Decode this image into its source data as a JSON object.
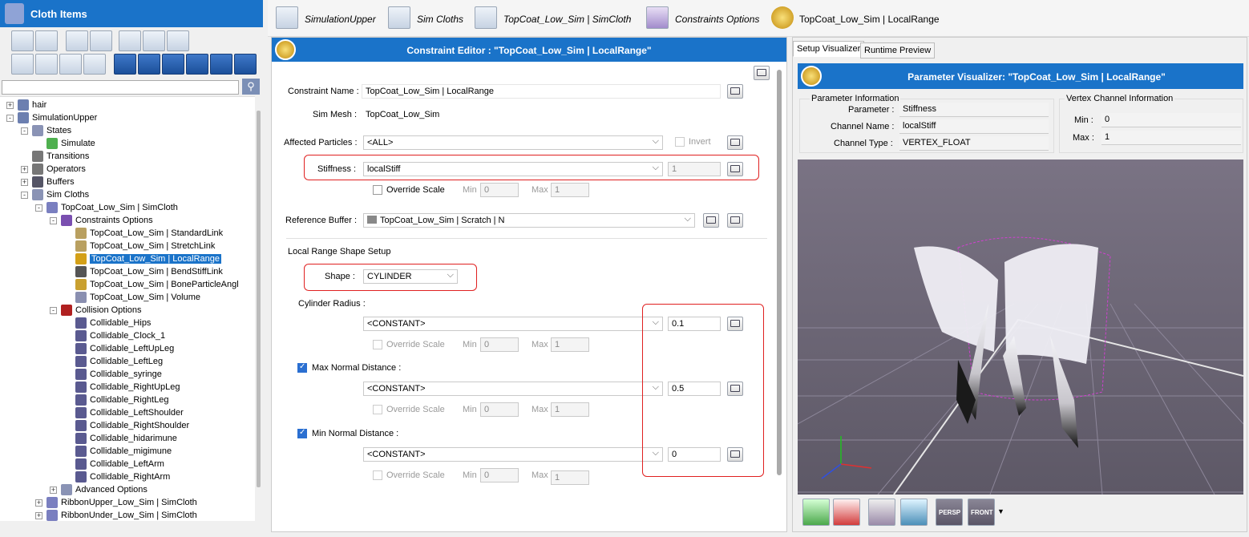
{
  "left_panel": {
    "title": "Cloth Items",
    "tree": [
      {
        "label": "hair",
        "indent": 0,
        "exp": "+",
        "color": "#6c7fb0"
      },
      {
        "label": "SimulationUpper",
        "indent": 0,
        "exp": "-",
        "color": "#6c7fb0"
      },
      {
        "label": "States",
        "indent": 1,
        "exp": "-",
        "color": "#8a93b5"
      },
      {
        "label": "Simulate",
        "indent": 2,
        "exp": "",
        "color": "#4fb04f"
      },
      {
        "label": "Transitions",
        "indent": 1,
        "exp": "",
        "color": "#777"
      },
      {
        "label": "Operators",
        "indent": 1,
        "exp": "+",
        "color": "#777"
      },
      {
        "label": "Buffers",
        "indent": 1,
        "exp": "+",
        "color": "#556"
      },
      {
        "label": "Sim Cloths",
        "indent": 1,
        "exp": "-",
        "color": "#8a93b5"
      },
      {
        "label": "TopCoat_Low_Sim | SimCloth",
        "indent": 2,
        "exp": "-",
        "color": "#7a7fc0"
      },
      {
        "label": "Constraints Options",
        "indent": 3,
        "exp": "-",
        "color": "#7a4fb0"
      },
      {
        "label": "TopCoat_Low_Sim | StandardLink",
        "indent": 4,
        "exp": "",
        "color": "#b9a060"
      },
      {
        "label": "TopCoat_Low_Sim | StretchLink",
        "indent": 4,
        "exp": "",
        "color": "#b9a060"
      },
      {
        "label": "TopCoat_Low_Sim | LocalRange",
        "indent": 4,
        "exp": "",
        "color": "#d4a017",
        "selected": true
      },
      {
        "label": "TopCoat_Low_Sim | BendStiffLink",
        "indent": 4,
        "exp": "",
        "color": "#555"
      },
      {
        "label": "TopCoat_Low_Sim | BoneParticleAngl",
        "indent": 4,
        "exp": "",
        "color": "#c9a030"
      },
      {
        "label": "TopCoat_Low_Sim | Volume",
        "indent": 4,
        "exp": "",
        "color": "#8a8fb0"
      },
      {
        "label": "Collision Options",
        "indent": 3,
        "exp": "-",
        "color": "#b02020"
      },
      {
        "label": "Collidable_Hips",
        "indent": 4,
        "exp": "",
        "color": "#5a5a90"
      },
      {
        "label": "Collidable_Clock_1",
        "indent": 4,
        "exp": "",
        "color": "#5a5a90"
      },
      {
        "label": "Collidable_LeftUpLeg",
        "indent": 4,
        "exp": "",
        "color": "#5a5a90"
      },
      {
        "label": "Collidable_LeftLeg",
        "indent": 4,
        "exp": "",
        "color": "#5a5a90"
      },
      {
        "label": "Collidable_syringe",
        "indent": 4,
        "exp": "",
        "color": "#5a5a90"
      },
      {
        "label": "Collidable_RightUpLeg",
        "indent": 4,
        "exp": "",
        "color": "#5a5a90"
      },
      {
        "label": "Collidable_RightLeg",
        "indent": 4,
        "exp": "",
        "color": "#5a5a90"
      },
      {
        "label": "Collidable_LeftShoulder",
        "indent": 4,
        "exp": "",
        "color": "#5a5a90"
      },
      {
        "label": "Collidable_RightShoulder",
        "indent": 4,
        "exp": "",
        "color": "#5a5a90"
      },
      {
        "label": "Collidable_hidarimune",
        "indent": 4,
        "exp": "",
        "color": "#5a5a90"
      },
      {
        "label": "Collidable_migimune",
        "indent": 4,
        "exp": "",
        "color": "#5a5a90"
      },
      {
        "label": "Collidable_LeftArm",
        "indent": 4,
        "exp": "",
        "color": "#5a5a90"
      },
      {
        "label": "Collidable_RightArm",
        "indent": 4,
        "exp": "",
        "color": "#5a5a90"
      },
      {
        "label": "Advanced Options",
        "indent": 3,
        "exp": "+",
        "color": "#8a93b5"
      },
      {
        "label": "RibbonUpper_Low_Sim | SimCloth",
        "indent": 2,
        "exp": "+",
        "color": "#7a7fc0"
      },
      {
        "label": "RibbonUnder_Low_Sim | SimCloth",
        "indent": 2,
        "exp": "+",
        "color": "#7a7fc0"
      }
    ]
  },
  "breadcrumb": [
    "SimulationUpper",
    "Sim Cloths",
    "TopCoat_Low_Sim | SimCloth",
    "Constraints Options",
    "TopCoat_Low_Sim | LocalRange"
  ],
  "editor": {
    "title": "Constraint Editor : \"TopCoat_Low_Sim | LocalRange\"",
    "constraint_name_label": "Constraint Name :",
    "constraint_name": "TopCoat_Low_Sim | LocalRange",
    "sim_mesh_label": "Sim Mesh :",
    "sim_mesh": "TopCoat_Low_Sim",
    "affected_label": "Affected Particles :",
    "affected": "<ALL>",
    "invert": "Invert",
    "stiffness_label": "Stiffness :",
    "stiffness": "localStiff",
    "stiffness_value": "1",
    "override_scale": "Override Scale",
    "min": "Min",
    "max": "Max",
    "min_val": "0",
    "max_val": "1",
    "ref_buffer_label": "Reference Buffer :",
    "ref_buffer": "TopCoat_Low_Sim | Scratch | N",
    "local_range_title": "Local Range Shape Setup",
    "shape_label": "Shape :",
    "shape": "CYLINDER",
    "cyl_radius_label": "Cylinder Radius :",
    "constant": "<CONSTANT>",
    "cyl_radius": "0.1",
    "max_normal_label": "Max Normal Distance :",
    "max_normal": "0.5",
    "min_normal_label": "Min Normal Distance :",
    "min_normal": "0"
  },
  "visualizer": {
    "tab_setup": "Setup Visualizer",
    "tab_runtime": "Runtime Preview",
    "title": "Parameter Visualizer: \"TopCoat_Low_Sim | LocalRange\"",
    "param_info_title": "Parameter Information",
    "parameter_label": "Parameter :",
    "parameter": "Stiffness",
    "channel_name_label": "Channel Name :",
    "channel_name": "localStiff",
    "channel_type_label": "Channel Type :",
    "channel_type": "VERTEX_FLOAT",
    "vertex_info_title": "Vertex Channel Information",
    "min_label": "Min :",
    "min": "0",
    "max_label": "Max :",
    "max": "1",
    "btn_persp": "PERSP",
    "btn_front": "FRONT"
  }
}
